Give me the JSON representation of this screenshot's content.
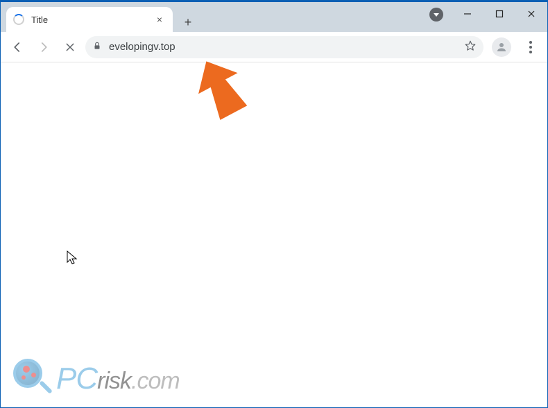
{
  "tab": {
    "title": "Title"
  },
  "address": {
    "url": "evelopingv.top"
  },
  "window": {
    "minimize": "−",
    "maximize": "□",
    "close": "×"
  },
  "watermark": {
    "pc": "PC",
    "risk": "risk",
    "com": ".com"
  },
  "colors": {
    "accent": "#1a73e8",
    "arrow": "#ec6a1f",
    "titlebar": "#cfd8e0",
    "border": "#0a5fb4"
  }
}
